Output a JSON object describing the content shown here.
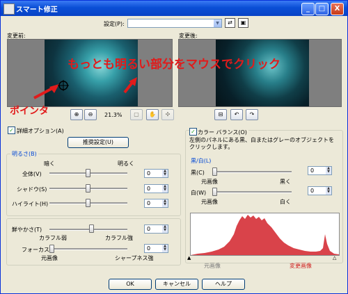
{
  "window": {
    "title": "スマート修正"
  },
  "titlebar": {
    "minimize": "_",
    "maximize": "□",
    "close": "X"
  },
  "settings": {
    "label": "設定(P):",
    "value": ""
  },
  "preview": {
    "before_label": "変更前:",
    "after_label": "変更後:",
    "zoom": "21.3%"
  },
  "annotations": {
    "instruction": "もっとも明るい部分をマウスでクリック",
    "pointer": "ポインタ"
  },
  "detail_option": {
    "label": "詳細オプション(A)",
    "checked": true
  },
  "recommended_button": "推奨設定(U)",
  "brightness": {
    "group_title": "明るさ(B)",
    "dark_label": "暗く",
    "bright_label": "明るく",
    "rows": [
      {
        "label": "全体(V)",
        "value": "0"
      },
      {
        "label": "シャドウ(S)",
        "value": "0"
      },
      {
        "label": "ハイライト(H)",
        "value": "0"
      }
    ]
  },
  "saturation": {
    "label": "鮮やかさ(T)",
    "value": "0",
    "left_label": "カラフル弱",
    "right_label": "カラフル強"
  },
  "focus": {
    "label": "フォーカス",
    "value": "0",
    "left_label": "元画像",
    "right_label": "シャープネス強"
  },
  "color_balance": {
    "label": "カラー バランス(O)",
    "checked": true,
    "description": "左側のパネルにある黒、白またはグレーのオブジェクトをクリックします。"
  },
  "black_white": {
    "group_title": "黒/白(L)",
    "black": {
      "label": "黒(C)",
      "value": "0",
      "left_label": "元画像",
      "right_label": "黒く"
    },
    "white": {
      "label": "白(W)",
      "value": "0",
      "left_label": "元画像",
      "right_label": "白く"
    }
  },
  "histogram": {
    "left_label": "元画像",
    "right_label": "変更画像"
  },
  "buttons": {
    "ok": "OK",
    "cancel": "キャンセル",
    "help": "ヘルプ"
  },
  "colors": {
    "accent": "#0046d5",
    "annotation": "#e11b1b",
    "histogram_fill": "#d9434a"
  }
}
